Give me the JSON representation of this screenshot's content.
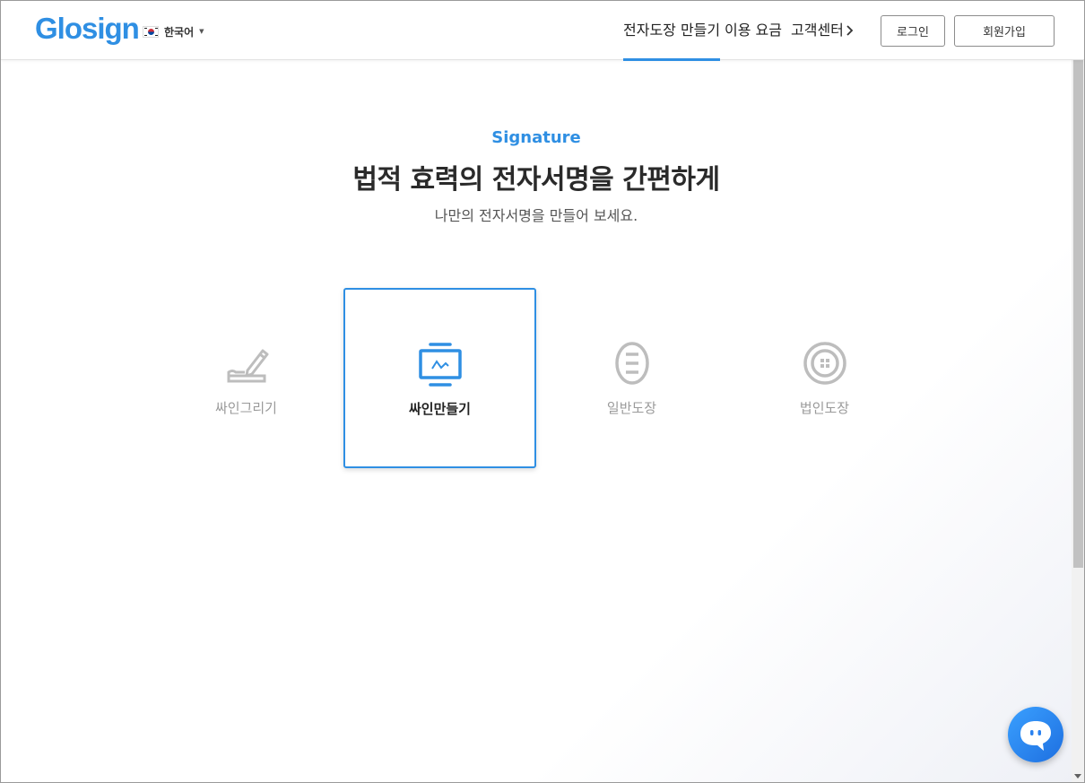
{
  "header": {
    "logo": "Glosign",
    "language": "한국어",
    "nav": [
      {
        "label": "전자도장 만들기",
        "active": true
      },
      {
        "label": "이용 요금",
        "active": false
      },
      {
        "label": "고객센터",
        "active": false
      }
    ],
    "login_label": "로그인",
    "signup_label": "회원가입"
  },
  "hero": {
    "kicker": "Signature",
    "title": "법적 효력의 전자서명을 간편하게",
    "subtitle": "나만의 전자서명을 만들어 보세요."
  },
  "options": [
    {
      "label": "싸인그리기",
      "icon": "pen-drawing-icon",
      "selected": false
    },
    {
      "label": "싸인만들기",
      "icon": "signature-monitor-icon",
      "selected": true
    },
    {
      "label": "일반도장",
      "icon": "oval-stamp-icon",
      "selected": false
    },
    {
      "label": "법인도장",
      "icon": "round-seal-icon",
      "selected": false
    }
  ],
  "colors": {
    "accent": "#2f8fe3",
    "inactive": "#bdbdbd",
    "chat": "#2a82f0"
  }
}
